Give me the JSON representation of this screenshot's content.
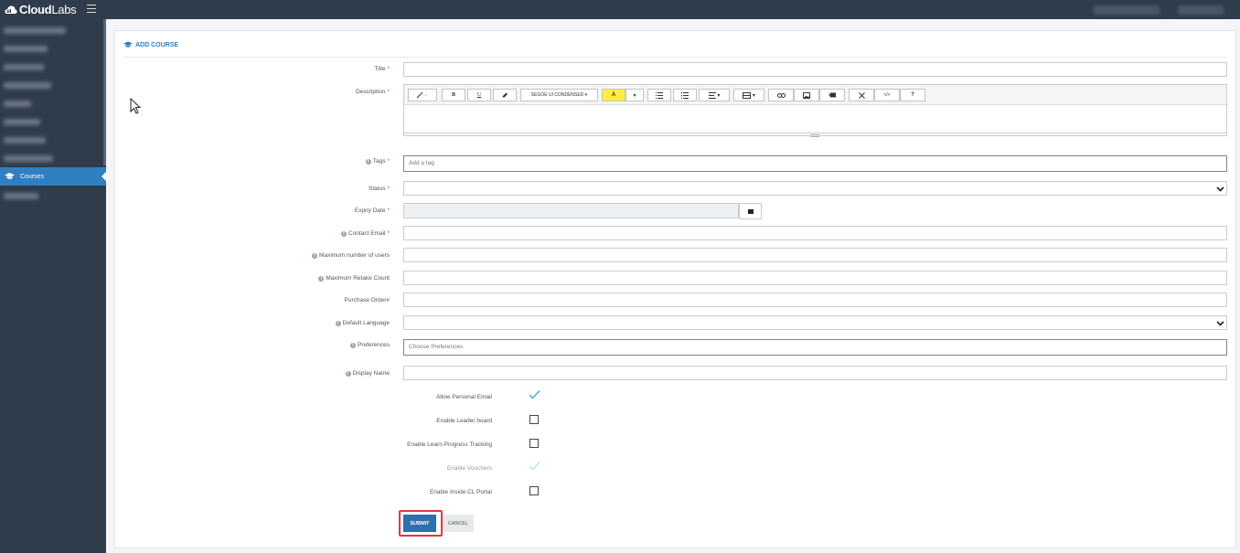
{
  "app": {
    "logo_bold": "Cloud",
    "logo_light": "Labs"
  },
  "sidebar": {
    "active_item": "Courses"
  },
  "page": {
    "heading": "ADD COURSE"
  },
  "form": {
    "title_label": "Title",
    "description_label": "Description",
    "tags_label": "Tags",
    "tags_placeholder": "Add a tag",
    "status_label": "Status",
    "expiry_label": "Expiry Date",
    "contact_email_label": "Contact Email",
    "max_users_label": "Maximum number of users",
    "max_retake_label": "Maximum Retake Count",
    "purchase_order_label": "Purchase Order#",
    "default_language_label": "Default Language",
    "preferences_label": "Preferences",
    "preferences_placeholder": "Choose Preferences",
    "display_name_label": "Display Name",
    "required_mark": "*"
  },
  "editor_toolbar": {
    "font_name": "SEGOE UI CONDENSED",
    "bold": "B",
    "underline": "U",
    "highlight": "A",
    "code": "</>",
    "help": "?"
  },
  "options": [
    {
      "label": "Allow Personal Email",
      "state": "checked"
    },
    {
      "label": "Enable Leader board",
      "state": "unchecked"
    },
    {
      "label": "Enable Learn Progress Tracking",
      "state": "unchecked"
    },
    {
      "label": "Enable Vouchers",
      "state": "checked-disabled"
    },
    {
      "label": "Enable Inside CL Portal",
      "state": "unchecked"
    }
  ],
  "actions": {
    "submit": "SUBMIT",
    "cancel": "CANCEL"
  },
  "colors": {
    "topbar": "#2f3c4b",
    "accent": "#2f7fc1",
    "submit": "#2f6fb0",
    "highlight_frame": "#e03a3a",
    "check": "#3aa9c9"
  }
}
